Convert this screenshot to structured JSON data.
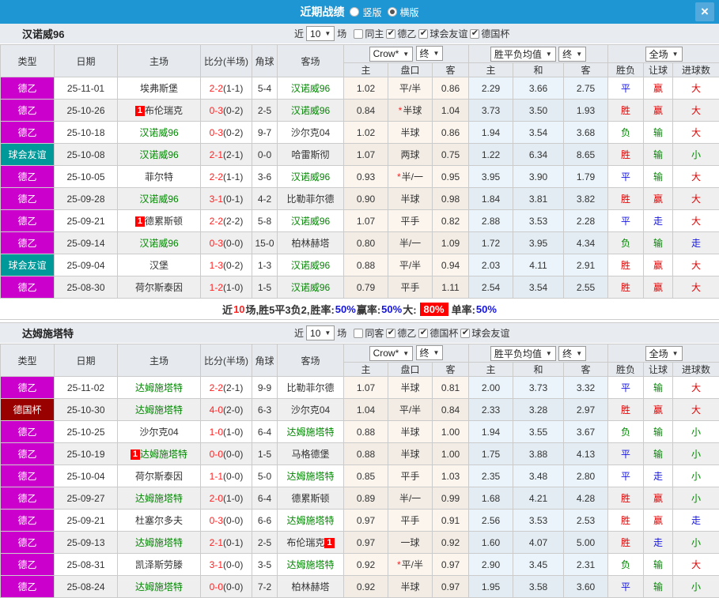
{
  "titlebar": {
    "title": "近期战绩",
    "radios": [
      {
        "label": "竖版",
        "checked": false
      },
      {
        "label": "横版",
        "checked": true
      }
    ],
    "close": "×",
    "bar_color": "#1E96D3"
  },
  "columns": {
    "type": "类型",
    "date": "日期",
    "home": "主场",
    "score": "比分(半场)",
    "corner": "角球",
    "away": "客场",
    "odds_home": "主",
    "handicap": "盘口",
    "odds_away": "客",
    "avg_home": "主",
    "avg_draw": "和",
    "avg_away": "客",
    "result": "胜负",
    "handicap_result": "让球",
    "goals": "进球数"
  },
  "controls": {
    "odds_source": "Crow*",
    "final": "终",
    "avg_label": "胜平负均值",
    "final2": "终",
    "fullmatch": "全场",
    "arrow": "▼"
  },
  "colors": {
    "league_de2": "#CC00CC",
    "friendly": "#009999",
    "cup": "#990000",
    "team_green": "#008800",
    "win_red": "#E60000",
    "draw_blue": "#1515DD",
    "lose_green": "#008800"
  },
  "sections": [
    {
      "team": "汉诺威96",
      "filter": {
        "near": "近",
        "count": "10",
        "unit": "场",
        "same": {
          "label": "同主",
          "checked": false
        },
        "options": [
          {
            "label": "德乙",
            "checked": true
          },
          {
            "label": "球会友谊",
            "checked": true
          },
          {
            "label": "德国杯",
            "checked": true
          }
        ]
      },
      "rows": [
        {
          "type": "德乙",
          "tk": "de2",
          "date": "25-11-01",
          "home": "埃弗斯堡",
          "hG": false,
          "hCard": "",
          "away": "汉诺威96",
          "aG": true,
          "aCard": "",
          "score": "2-2",
          "half": "(1-1)",
          "corner": "5-4",
          "o1": "1.02",
          "hc": "平/半",
          "star": false,
          "o2": "0.86",
          "a1": "2.29",
          "a2": "3.66",
          "a3": "2.75",
          "r1": {
            "t": "平",
            "c": "b"
          },
          "r2": {
            "t": "赢",
            "c": "r"
          },
          "r3": {
            "t": "大",
            "c": "r"
          }
        },
        {
          "type": "德乙",
          "tk": "de2",
          "date": "25-10-26",
          "home": "布伦瑞克",
          "hG": false,
          "hCard": "1",
          "away": "汉诺威96",
          "aG": true,
          "aCard": "",
          "score": "0-3",
          "half": "(0-2)",
          "corner": "2-5",
          "o1": "0.84",
          "hc": "半球",
          "star": true,
          "o2": "1.04",
          "a1": "3.73",
          "a2": "3.50",
          "a3": "1.93",
          "r1": {
            "t": "胜",
            "c": "r"
          },
          "r2": {
            "t": "赢",
            "c": "r"
          },
          "r3": {
            "t": "大",
            "c": "r"
          }
        },
        {
          "type": "德乙",
          "tk": "de2",
          "date": "25-10-18",
          "home": "汉诺威96",
          "hG": true,
          "hCard": "",
          "away": "沙尔克04",
          "aG": false,
          "aCard": "",
          "score": "0-3",
          "half": "(0-2)",
          "corner": "9-7",
          "o1": "1.02",
          "hc": "半球",
          "star": false,
          "o2": "0.86",
          "a1": "1.94",
          "a2": "3.54",
          "a3": "3.68",
          "r1": {
            "t": "负",
            "c": "g"
          },
          "r2": {
            "t": "输",
            "c": "g"
          },
          "r3": {
            "t": "大",
            "c": "r"
          }
        },
        {
          "type": "球会友谊",
          "tk": "fr",
          "date": "25-10-08",
          "home": "汉诺威96",
          "hG": true,
          "hCard": "",
          "away": "哈雷斯彻",
          "aG": false,
          "aCard": "",
          "score": "2-1",
          "half": "(2-1)",
          "corner": "0-0",
          "o1": "1.07",
          "hc": "两球",
          "star": false,
          "o2": "0.75",
          "a1": "1.22",
          "a2": "6.34",
          "a3": "8.65",
          "r1": {
            "t": "胜",
            "c": "r"
          },
          "r2": {
            "t": "输",
            "c": "g"
          },
          "r3": {
            "t": "小",
            "c": "g"
          }
        },
        {
          "type": "德乙",
          "tk": "de2",
          "date": "25-10-05",
          "home": "菲尔特",
          "hG": false,
          "hCard": "",
          "away": "汉诺威96",
          "aG": true,
          "aCard": "",
          "score": "2-2",
          "half": "(1-1)",
          "corner": "3-6",
          "o1": "0.93",
          "hc": "半/一",
          "star": true,
          "o2": "0.95",
          "a1": "3.95",
          "a2": "3.90",
          "a3": "1.79",
          "r1": {
            "t": "平",
            "c": "b"
          },
          "r2": {
            "t": "输",
            "c": "g"
          },
          "r3": {
            "t": "大",
            "c": "r"
          }
        },
        {
          "type": "德乙",
          "tk": "de2",
          "date": "25-09-28",
          "home": "汉诺威96",
          "hG": true,
          "hCard": "",
          "away": "比勒菲尔德",
          "aG": false,
          "aCard": "",
          "score": "3-1",
          "half": "(0-1)",
          "corner": "4-2",
          "o1": "0.90",
          "hc": "半球",
          "star": false,
          "o2": "0.98",
          "a1": "1.84",
          "a2": "3.81",
          "a3": "3.82",
          "r1": {
            "t": "胜",
            "c": "r"
          },
          "r2": {
            "t": "赢",
            "c": "r"
          },
          "r3": {
            "t": "大",
            "c": "r"
          }
        },
        {
          "type": "德乙",
          "tk": "de2",
          "date": "25-09-21",
          "home": "德累斯顿",
          "hG": false,
          "hCard": "1",
          "away": "汉诺威96",
          "aG": true,
          "aCard": "",
          "score": "2-2",
          "half": "(2-2)",
          "corner": "5-8",
          "o1": "1.07",
          "hc": "平手",
          "star": false,
          "o2": "0.82",
          "a1": "2.88",
          "a2": "3.53",
          "a3": "2.28",
          "r1": {
            "t": "平",
            "c": "b"
          },
          "r2": {
            "t": "走",
            "c": "b"
          },
          "r3": {
            "t": "大",
            "c": "r"
          }
        },
        {
          "type": "德乙",
          "tk": "de2",
          "date": "25-09-14",
          "home": "汉诺威96",
          "hG": true,
          "hCard": "",
          "away": "柏林赫塔",
          "aG": false,
          "aCard": "",
          "score": "0-3",
          "half": "(0-0)",
          "corner": "15-0",
          "o1": "0.80",
          "hc": "半/一",
          "star": false,
          "o2": "1.09",
          "a1": "1.72",
          "a2": "3.95",
          "a3": "4.34",
          "r1": {
            "t": "负",
            "c": "g"
          },
          "r2": {
            "t": "输",
            "c": "g"
          },
          "r3": {
            "t": "走",
            "c": "b"
          }
        },
        {
          "type": "球会友谊",
          "tk": "fr",
          "date": "25-09-04",
          "home": "汉堡",
          "hG": false,
          "hCard": "",
          "away": "汉诺威96",
          "aG": true,
          "aCard": "",
          "score": "1-3",
          "half": "(0-2)",
          "corner": "1-3",
          "o1": "0.88",
          "hc": "平/半",
          "star": false,
          "o2": "0.94",
          "a1": "2.03",
          "a2": "4.11",
          "a3": "2.91",
          "r1": {
            "t": "胜",
            "c": "r"
          },
          "r2": {
            "t": "赢",
            "c": "r"
          },
          "r3": {
            "t": "大",
            "c": "r"
          }
        },
        {
          "type": "德乙",
          "tk": "de2",
          "date": "25-08-30",
          "home": "荷尔斯泰因",
          "hG": false,
          "hCard": "",
          "away": "汉诺威96",
          "aG": true,
          "aCard": "",
          "score": "1-2",
          "half": "(1-0)",
          "corner": "1-5",
          "o1": "0.79",
          "hc": "平手",
          "star": false,
          "o2": "1.11",
          "a1": "2.54",
          "a2": "3.54",
          "a3": "2.55",
          "r1": {
            "t": "胜",
            "c": "r"
          },
          "r2": {
            "t": "赢",
            "c": "r"
          },
          "r3": {
            "t": "大",
            "c": "r"
          }
        }
      ],
      "summary": [
        {
          "t": "近"
        },
        {
          "t": "10",
          "c": "red"
        },
        {
          "t": "场,胜5平3负2, "
        },
        {
          "t": "胜率:"
        },
        {
          "t": "50%",
          "c": "blue"
        },
        {
          "t": " 赢率:"
        },
        {
          "t": "50%",
          "c": "blue"
        },
        {
          "t": " 大:"
        },
        {
          "t": "80%",
          "c": "redbg"
        },
        {
          "t": "单率:"
        },
        {
          "t": "50%",
          "c": "blue"
        }
      ]
    },
    {
      "team": "达姆施塔特",
      "filter": {
        "near": "近",
        "count": "10",
        "unit": "场",
        "same": {
          "label": "同客",
          "checked": false
        },
        "options": [
          {
            "label": "德乙",
            "checked": true
          },
          {
            "label": "德国杯",
            "checked": true
          },
          {
            "label": "球会友谊",
            "checked": true
          }
        ]
      },
      "rows": [
        {
          "type": "德乙",
          "tk": "de2",
          "date": "25-11-02",
          "home": "达姆施塔特",
          "hG": true,
          "hCard": "",
          "away": "比勒菲尔德",
          "aG": false,
          "aCard": "",
          "score": "2-2",
          "half": "(2-1)",
          "corner": "9-9",
          "o1": "1.07",
          "hc": "半球",
          "star": false,
          "o2": "0.81",
          "a1": "2.00",
          "a2": "3.73",
          "a3": "3.32",
          "r1": {
            "t": "平",
            "c": "b"
          },
          "r2": {
            "t": "输",
            "c": "g"
          },
          "r3": {
            "t": "大",
            "c": "r"
          }
        },
        {
          "type": "德国杯",
          "tk": "cup",
          "date": "25-10-30",
          "home": "达姆施塔特",
          "hG": true,
          "hCard": "",
          "away": "沙尔克04",
          "aG": false,
          "aCard": "",
          "score": "4-0",
          "half": "(2-0)",
          "corner": "6-3",
          "o1": "1.04",
          "hc": "平/半",
          "star": false,
          "o2": "0.84",
          "a1": "2.33",
          "a2": "3.28",
          "a3": "2.97",
          "r1": {
            "t": "胜",
            "c": "r"
          },
          "r2": {
            "t": "赢",
            "c": "r"
          },
          "r3": {
            "t": "大",
            "c": "r"
          }
        },
        {
          "type": "德乙",
          "tk": "de2",
          "date": "25-10-25",
          "home": "沙尔克04",
          "hG": false,
          "hCard": "",
          "away": "达姆施塔特",
          "aG": true,
          "aCard": "",
          "score": "1-0",
          "half": "(1-0)",
          "corner": "6-4",
          "o1": "0.88",
          "hc": "半球",
          "star": false,
          "o2": "1.00",
          "a1": "1.94",
          "a2": "3.55",
          "a3": "3.67",
          "r1": {
            "t": "负",
            "c": "g"
          },
          "r2": {
            "t": "输",
            "c": "g"
          },
          "r3": {
            "t": "小",
            "c": "g"
          }
        },
        {
          "type": "德乙",
          "tk": "de2",
          "date": "25-10-19",
          "home": "达姆施塔特",
          "hG": true,
          "hCard": "1",
          "away": "马格德堡",
          "aG": false,
          "aCard": "",
          "score": "0-0",
          "half": "(0-0)",
          "corner": "1-5",
          "o1": "0.88",
          "hc": "半球",
          "star": false,
          "o2": "1.00",
          "a1": "1.75",
          "a2": "3.88",
          "a3": "4.13",
          "r1": {
            "t": "平",
            "c": "b"
          },
          "r2": {
            "t": "输",
            "c": "g"
          },
          "r3": {
            "t": "小",
            "c": "g"
          }
        },
        {
          "type": "德乙",
          "tk": "de2",
          "date": "25-10-04",
          "home": "荷尔斯泰因",
          "hG": false,
          "hCard": "",
          "away": "达姆施塔特",
          "aG": true,
          "aCard": "",
          "score": "1-1",
          "half": "(0-0)",
          "corner": "5-0",
          "o1": "0.85",
          "hc": "平手",
          "star": false,
          "o2": "1.03",
          "a1": "2.35",
          "a2": "3.48",
          "a3": "2.80",
          "r1": {
            "t": "平",
            "c": "b"
          },
          "r2": {
            "t": "走",
            "c": "b"
          },
          "r3": {
            "t": "小",
            "c": "g"
          }
        },
        {
          "type": "德乙",
          "tk": "de2",
          "date": "25-09-27",
          "home": "达姆施塔特",
          "hG": true,
          "hCard": "",
          "away": "德累斯顿",
          "aG": false,
          "aCard": "",
          "score": "2-0",
          "half": "(1-0)",
          "corner": "6-4",
          "o1": "0.89",
          "hc": "半/一",
          "star": false,
          "o2": "0.99",
          "a1": "1.68",
          "a2": "4.21",
          "a3": "4.28",
          "r1": {
            "t": "胜",
            "c": "r"
          },
          "r2": {
            "t": "赢",
            "c": "r"
          },
          "r3": {
            "t": "小",
            "c": "g"
          }
        },
        {
          "type": "德乙",
          "tk": "de2",
          "date": "25-09-21",
          "home": "杜塞尔多夫",
          "hG": false,
          "hCard": "",
          "away": "达姆施塔特",
          "aG": true,
          "aCard": "",
          "score": "0-3",
          "half": "(0-0)",
          "corner": "6-6",
          "o1": "0.97",
          "hc": "平手",
          "star": false,
          "o2": "0.91",
          "a1": "2.56",
          "a2": "3.53",
          "a3": "2.53",
          "r1": {
            "t": "胜",
            "c": "r"
          },
          "r2": {
            "t": "赢",
            "c": "r"
          },
          "r3": {
            "t": "走",
            "c": "b"
          }
        },
        {
          "type": "德乙",
          "tk": "de2",
          "date": "25-09-13",
          "home": "达姆施塔特",
          "hG": true,
          "hCard": "",
          "away": "布伦瑞克",
          "aG": false,
          "aCard": "1",
          "score": "2-1",
          "half": "(0-1)",
          "corner": "2-5",
          "o1": "0.97",
          "hc": "一球",
          "star": false,
          "o2": "0.92",
          "a1": "1.60",
          "a2": "4.07",
          "a3": "5.00",
          "r1": {
            "t": "胜",
            "c": "r"
          },
          "r2": {
            "t": "走",
            "c": "b"
          },
          "r3": {
            "t": "小",
            "c": "g"
          }
        },
        {
          "type": "德乙",
          "tk": "de2",
          "date": "25-08-31",
          "home": "凯泽斯劳滕",
          "hG": false,
          "hCard": "",
          "away": "达姆施塔特",
          "aG": true,
          "aCard": "",
          "score": "3-1",
          "half": "(0-0)",
          "corner": "3-5",
          "o1": "0.92",
          "hc": "平/半",
          "star": true,
          "o2": "0.97",
          "a1": "2.90",
          "a2": "3.45",
          "a3": "2.31",
          "r1": {
            "t": "负",
            "c": "g"
          },
          "r2": {
            "t": "输",
            "c": "g"
          },
          "r3": {
            "t": "大",
            "c": "r"
          }
        },
        {
          "type": "德乙",
          "tk": "de2",
          "date": "25-08-24",
          "home": "达姆施塔特",
          "hG": true,
          "hCard": "",
          "away": "柏林赫塔",
          "aG": false,
          "aCard": "",
          "score": "0-0",
          "half": "(0-0)",
          "corner": "7-2",
          "o1": "0.92",
          "hc": "半球",
          "star": false,
          "o2": "0.97",
          "a1": "1.95",
          "a2": "3.58",
          "a3": "3.60",
          "r1": {
            "t": "平",
            "c": "b"
          },
          "r2": {
            "t": "输",
            "c": "g"
          },
          "r3": {
            "t": "小",
            "c": "g"
          }
        }
      ],
      "summary": []
    }
  ]
}
